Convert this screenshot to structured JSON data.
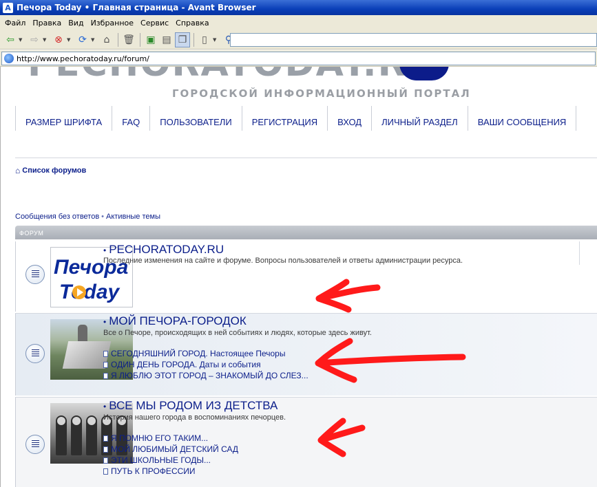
{
  "window": {
    "title": "Печора Today • Главная страница - Avant Browser",
    "app_icon": "A"
  },
  "menu": [
    "Файл",
    "Правка",
    "Вид",
    "Избранное",
    "Сервис",
    "Справка"
  ],
  "address": {
    "url": "http://www.pechoratoday.ru/forum/"
  },
  "site": {
    "tagline": "ГОРОДСКОЙ ИНФОРМАЦИОННЫЙ ПОРТАЛ",
    "nav": [
      "РАЗМЕР ШРИФТА",
      "FAQ",
      "ПОЛЬЗОВАТЕЛИ",
      "РЕГИСТРАЦИЯ",
      "ВХОД",
      "ЛИЧНЫЙ РАЗДЕЛ",
      "ВАШИ СООБЩЕНИЯ"
    ],
    "breadcrumb": "Список форумов",
    "quicklinks": [
      "Сообщения без ответов",
      "Активные темы"
    ],
    "table_header": "ФОРУМ"
  },
  "forums": [
    {
      "title": "PECHORATODAY.RU",
      "desc": "Последние изменения на сайте и форуме. Вопросы пользователей и ответы администрации ресурса.",
      "logo_word1": "Печора",
      "logo_word2": "Today",
      "subs": []
    },
    {
      "title": "МОЙ ПЕЧОРА-ГОРОДОК",
      "desc": "Все о Печоре, происходящих в ней событиях и людях, которые здесь живут.",
      "subs": [
        "СЕГОДНЯШНИЙ ГОРОД. Настоящее Печоры",
        "ОДИН ДЕНЬ ГОРОДА. Даты и события",
        "Я ЛЮБЛЮ ЭТОТ ГОРОД – ЗНАКОМЫЙ ДО СЛЕЗ..."
      ]
    },
    {
      "title": "ВСЕ МЫ РОДОМ ИЗ ДЕТСТВА",
      "desc": "История нашего города в воспоминаниях печорцев.",
      "subs": [
        "Я ПОМНЮ ЕГО ТАКИМ...",
        "МОЙ ЛЮБИМЫЙ ДЕТСКИЙ САД",
        "ЭТИ ШКОЛЬНЫЕ ГОДЫ...",
        "ПУТЬ К ПРОФЕССИИ"
      ]
    }
  ],
  "colors": {
    "link": "#0b1e8a",
    "annotation_arrow": "#ff1a1a",
    "titlebar": "#0a3fb8"
  }
}
